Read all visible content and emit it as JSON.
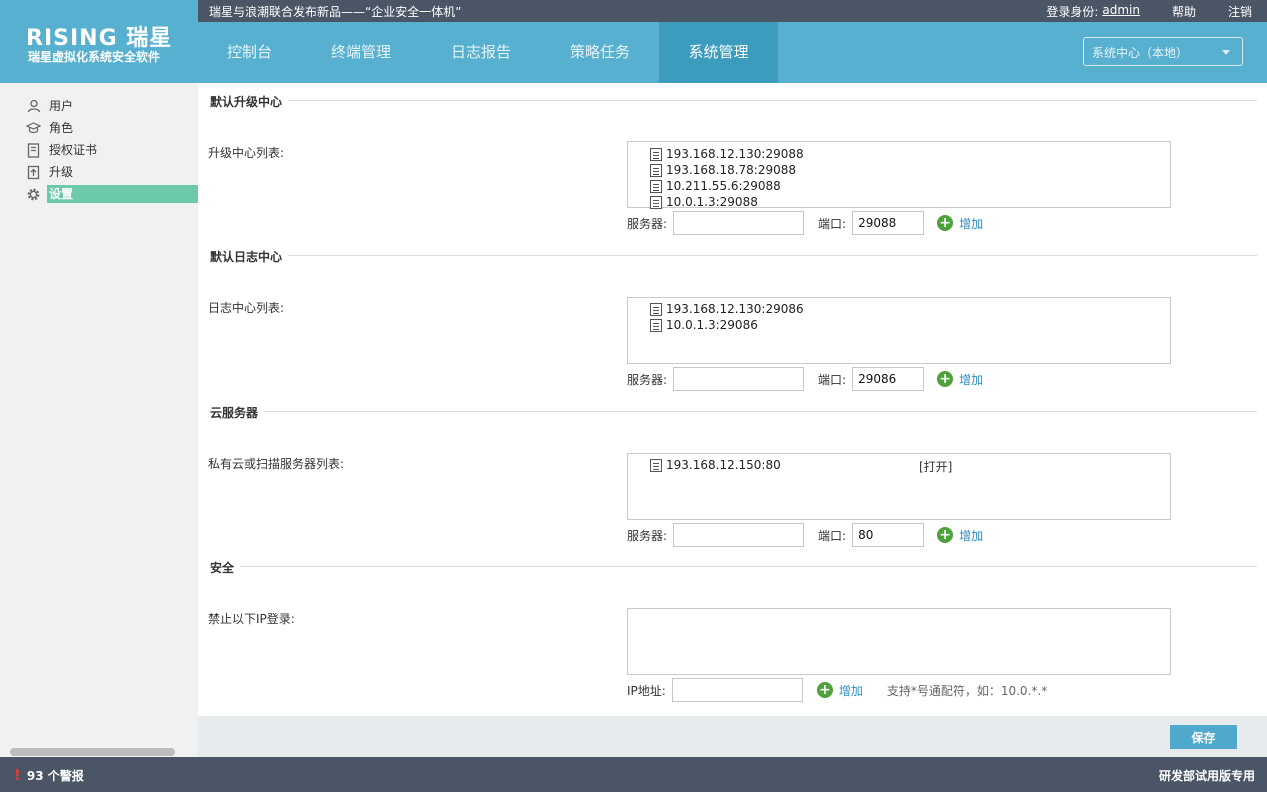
{
  "brand": {
    "logo_text": "RISING 瑞星",
    "subtitle": "瑞星虚拟化系统安全软件"
  },
  "topbar": {
    "news": "瑞星与浪潮联合发布新品——“企业安全一体机”",
    "login_label": "登录身份:",
    "user": "admin",
    "help": "帮助",
    "logout": "注销"
  },
  "nav": {
    "tabs": [
      "控制台",
      "终端管理",
      "日志报告",
      "策略任务",
      "系统管理"
    ],
    "active": "系统管理",
    "center_select": "系统中心（本地）"
  },
  "sidebar": {
    "items": [
      {
        "label": "用户",
        "icon": "user-icon"
      },
      {
        "label": "角色",
        "icon": "graduation-cap-icon"
      },
      {
        "label": "授权证书",
        "icon": "certificate-icon"
      },
      {
        "label": "升级",
        "icon": "upgrade-icon"
      },
      {
        "label": "设置",
        "icon": "gear-icon"
      }
    ],
    "active": "设置"
  },
  "sections": {
    "upgrade": {
      "title": "默认升级中心",
      "list_label": "升级中心列表:",
      "entries": [
        "193.168.12.130:29088",
        "193.168.18.78:29088",
        "10.211.55.6:29088",
        "10.0.1.3:29088"
      ],
      "server_label": "服务器:",
      "server_value": "",
      "port_label": "端口:",
      "port_value": "29088",
      "add": "增加"
    },
    "log": {
      "title": "默认日志中心",
      "list_label": "日志中心列表:",
      "entries": [
        "193.168.12.130:29086",
        "10.0.1.3:29086"
      ],
      "server_label": "服务器:",
      "server_value": "",
      "port_label": "端口:",
      "port_value": "29086",
      "add": "增加"
    },
    "cloud": {
      "title": "云服务器",
      "list_label": "私有云或扫描服务器列表:",
      "entries": [
        "193.168.12.150:80"
      ],
      "open_link": "[打开]",
      "server_label": "服务器:",
      "server_value": "",
      "port_label": "端口:",
      "port_value": "80",
      "add": "增加"
    },
    "security": {
      "title": "安全",
      "list_label": "禁止以下IP登录:",
      "entries": [],
      "ip_label": "IP地址:",
      "ip_value": "",
      "add": "增加",
      "hint": "支持*号通配符，如：10.0.*.*"
    }
  },
  "footer": {
    "save": "保存"
  },
  "status": {
    "alarm": "93 个警报",
    "edition": "研发部试用版专用"
  },
  "colors": {
    "header_blue": "#57b0cf",
    "active_tab": "#3c9cbd",
    "dark_bar": "#4a5566",
    "active_side": "#6ccaa9",
    "add_green": "#4ea13b"
  }
}
